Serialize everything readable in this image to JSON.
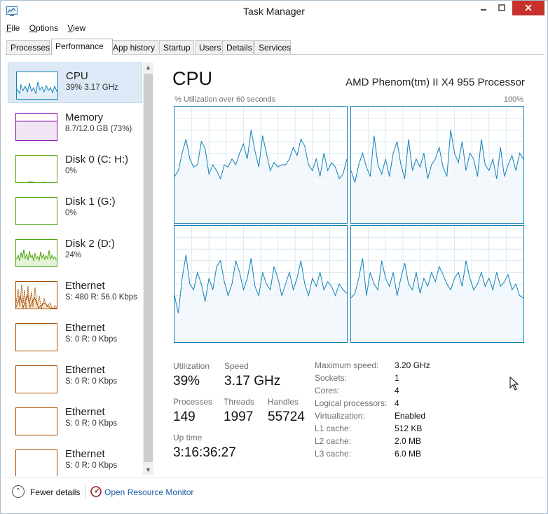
{
  "window": {
    "title": "Task Manager"
  },
  "menu": [
    "File",
    "Options",
    "View"
  ],
  "tabs": [
    "Processes",
    "Performance",
    "App history",
    "Startup",
    "Users",
    "Details",
    "Services"
  ],
  "active_tab": "Performance",
  "colors": {
    "cpu": "#1182b8",
    "memory": "#8b12ae",
    "disk": "#4da60c",
    "ethernet": "#a74f01",
    "selected": "#dde9f6"
  },
  "sidebar": [
    {
      "name": "CPU",
      "detail": "39% 3.17 GHz",
      "kind": "cpu"
    },
    {
      "name": "Memory",
      "detail": "8.7/12.0 GB (73%)",
      "kind": "memory"
    },
    {
      "name": "Disk 0 (C: H:)",
      "detail": "0%",
      "kind": "disk"
    },
    {
      "name": "Disk 1 (G:)",
      "detail": "0%",
      "kind": "disk"
    },
    {
      "name": "Disk 2 (D:)",
      "detail": "24%",
      "kind": "disk"
    },
    {
      "name": "Ethernet",
      "detail": "S: 480 R: 56.0 Kbps",
      "kind": "ethernet"
    },
    {
      "name": "Ethernet",
      "detail": "S: 0 R: 0 Kbps",
      "kind": "ethernet"
    },
    {
      "name": "Ethernet",
      "detail": "S: 0 R: 0 Kbps",
      "kind": "ethernet"
    },
    {
      "name": "Ethernet",
      "detail": "S: 0 R: 0 Kbps",
      "kind": "ethernet"
    },
    {
      "name": "Ethernet",
      "detail": "S: 0 R: 0 Kbps",
      "kind": "ethernet"
    }
  ],
  "main": {
    "title": "CPU",
    "processor": "AMD Phenom(tm) II X4 955 Processor",
    "graph_label": "% Utilization over 60 seconds",
    "graph_max": "100%",
    "stats": {
      "utilization_label": "Utilization",
      "utilization": "39%",
      "speed_label": "Speed",
      "speed": "3.17 GHz",
      "processes_label": "Processes",
      "processes": "149",
      "threads_label": "Threads",
      "threads": "1997",
      "handles_label": "Handles",
      "handles": "55724",
      "uptime_label": "Up time",
      "uptime": "3:16:36:27"
    },
    "specs": [
      {
        "label": "Maximum speed:",
        "value": "3.20 GHz"
      },
      {
        "label": "Sockets:",
        "value": "1"
      },
      {
        "label": "Cores:",
        "value": "4"
      },
      {
        "label": "Logical processors:",
        "value": "4"
      },
      {
        "label": "Virtualization:",
        "value": "Enabled"
      },
      {
        "label": "L1 cache:",
        "value": "512 KB"
      },
      {
        "label": "L2 cache:",
        "value": "2.0 MB"
      },
      {
        "label": "L3 cache:",
        "value": "6.0 MB"
      }
    ]
  },
  "core_utilization_percent": [
    [
      40,
      45,
      60,
      72,
      55,
      48,
      50,
      70,
      64,
      42,
      50,
      45,
      38,
      50,
      48,
      55,
      50,
      60,
      68,
      55,
      80,
      62,
      48,
      75,
      60,
      45,
      52,
      48,
      50,
      50,
      55,
      65,
      58,
      72,
      66,
      50,
      45,
      55,
      40,
      60,
      45,
      52,
      48,
      38,
      42,
      55
    ],
    [
      45,
      35,
      50,
      60,
      48,
      40,
      75,
      50,
      42,
      55,
      40,
      60,
      70,
      50,
      38,
      72,
      45,
      55,
      48,
      60,
      38,
      50,
      55,
      65,
      48,
      40,
      80,
      60,
      52,
      70,
      45,
      60,
      55,
      40,
      72,
      50,
      45,
      55,
      38,
      65,
      40,
      50,
      58,
      45,
      60,
      55
    ],
    [
      40,
      25,
      55,
      75,
      50,
      45,
      60,
      50,
      35,
      55,
      45,
      65,
      70,
      52,
      40,
      50,
      70,
      60,
      45,
      55,
      72,
      48,
      40,
      60,
      50,
      45,
      65,
      55,
      40,
      50,
      60,
      45,
      55,
      70,
      50,
      40,
      55,
      48,
      60,
      45,
      52,
      48,
      40,
      50,
      45,
      42
    ],
    [
      38,
      42,
      55,
      72,
      40,
      60,
      50,
      45,
      70,
      55,
      48,
      60,
      40,
      55,
      68,
      50,
      45,
      60,
      42,
      55,
      48,
      60,
      52,
      65,
      58,
      50,
      45,
      55,
      60,
      48,
      70,
      55,
      45,
      50,
      60,
      48,
      55,
      45,
      60,
      48,
      52,
      58,
      45,
      50,
      40,
      38
    ]
  ],
  "footer": {
    "fewer_details": "Fewer details",
    "resource_monitor": "Open Resource Monitor"
  }
}
